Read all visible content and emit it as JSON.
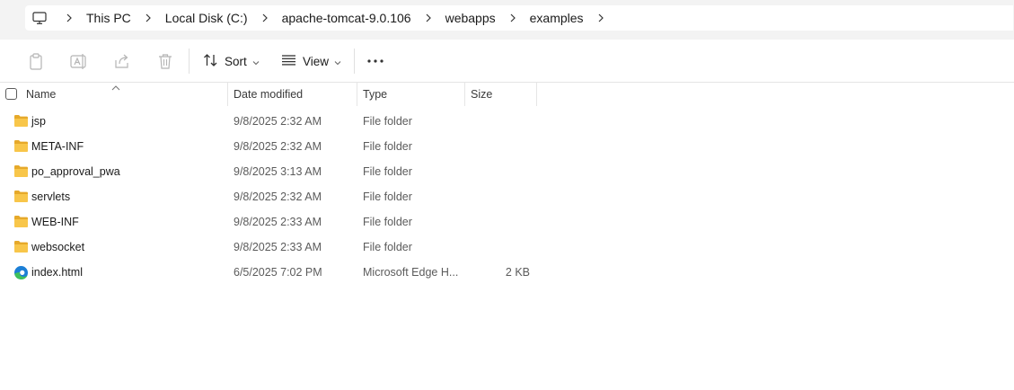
{
  "breadcrumb": {
    "segments": [
      "This PC",
      "Local Disk (C:)",
      "apache-tomcat-9.0.106",
      "webapps",
      "examples"
    ]
  },
  "toolbar": {
    "sort_label": "Sort",
    "view_label": "View"
  },
  "columns": {
    "name": "Name",
    "date_modified": "Date modified",
    "type": "Type",
    "size": "Size"
  },
  "files": [
    {
      "name": "jsp",
      "date": "9/8/2025 2:32 AM",
      "type": "File folder",
      "size": "",
      "icon": "folder-icon"
    },
    {
      "name": "META-INF",
      "date": "9/8/2025 2:32 AM",
      "type": "File folder",
      "size": "",
      "icon": "folder-icon"
    },
    {
      "name": "po_approval_pwa",
      "date": "9/8/2025 3:13 AM",
      "type": "File folder",
      "size": "",
      "icon": "folder-icon"
    },
    {
      "name": "servlets",
      "date": "9/8/2025 2:32 AM",
      "type": "File folder",
      "size": "",
      "icon": "folder-icon"
    },
    {
      "name": "WEB-INF",
      "date": "9/8/2025 2:33 AM",
      "type": "File folder",
      "size": "",
      "icon": "folder-icon"
    },
    {
      "name": "websocket",
      "date": "9/8/2025 2:33 AM",
      "type": "File folder",
      "size": "",
      "icon": "folder-icon"
    },
    {
      "name": "index.html",
      "date": "6/5/2025 7:02 PM",
      "type": "Microsoft Edge H...",
      "size": "2 KB",
      "icon": "edge-html-icon"
    }
  ],
  "colors": {
    "folder": "#f8c64a",
    "folder_dark": "#e6a92a",
    "edge_blue": "#1c7fd6",
    "edge_green": "#3fc15a"
  }
}
